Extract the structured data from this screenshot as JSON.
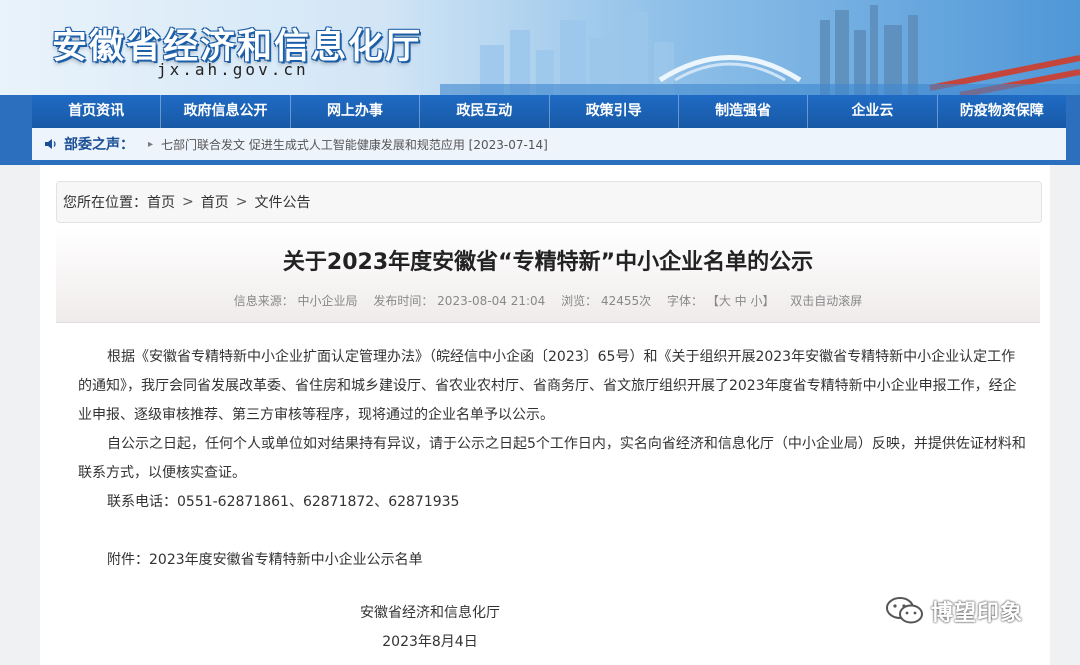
{
  "header": {
    "title": "安徽省经济和信息化厅",
    "url": "jx.ah.gov.cn"
  },
  "nav": {
    "items": [
      "首页资讯",
      "政府信息公开",
      "网上办事",
      "政民互动",
      "政策引导",
      "制造强省",
      "企业云",
      "防疫物资保障"
    ]
  },
  "notice": {
    "label": "部委之声：",
    "arrow": "▸",
    "message": "七部门联合发文 促进生成式人工智能健康发展和规范应用 [2023-07-14]"
  },
  "breadcrumb": {
    "prefix": "您所在位置：",
    "items": [
      "首页",
      "首页",
      "文件公告"
    ],
    "separator": ">"
  },
  "article": {
    "title": "关于2023年度安徽省“专精特新”中小企业名单的公示",
    "meta": {
      "source": "信息来源：  中小企业局",
      "published": "发布时间：  2023-08-04 21:04",
      "views": "浏览：  42455次",
      "font_label": "字体：",
      "font_sizes": "【大 中 小】",
      "autoscroll": "双击自动滚屏"
    },
    "paragraphs": [
      "根据《安徽省专精特新中小企业扩面认定管理办法》（皖经信中小企函〔2023〕65号）和《关于组织开展2023年安徽省专精特新中小企业认定工作的通知》，我厅会同省发展改革委、省住房和城乡建设厅、省农业农村厅、省商务厅、省文旅厅组织开展了2023年度省专精特新中小企业申报工作，经企业申报、逐级审核推荐、第三方审核等程序，现将通过的企业名单予以公示。",
      "自公示之日起，任何个人或单位如对结果持有异议，请于公示之日起5个工作日内，实名向省经济和信息化厅（中小企业局）反映，并提供佐证材料和联系方式，以便核实查证。",
      "联系电话：0551-62871861、62871872、62871935"
    ],
    "attachment": "附件：2023年度安徽省专精特新中小企业公示名单",
    "signature": "安徽省经济和信息化厅",
    "date": "2023年8月4日"
  },
  "watermark": {
    "text": "博望印象",
    "icon": "wechat-icon"
  },
  "colors": {
    "nav_bg": "#1f6bc4",
    "title_text": "#ffffff",
    "notice_label": "#1a4f95"
  }
}
